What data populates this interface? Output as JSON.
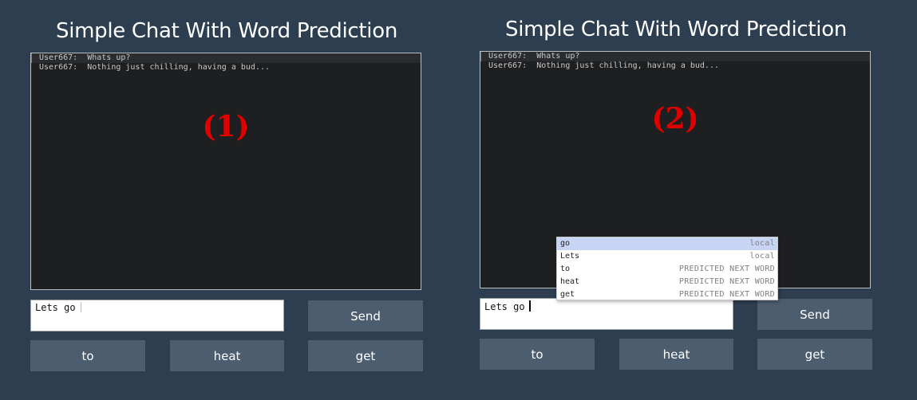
{
  "panels": [
    {
      "title": "Simple Chat With Word Prediction",
      "marker": "(1)",
      "chat": [
        {
          "user": "User667:",
          "text": "Whats up?"
        },
        {
          "user": "User667:",
          "text": "Nothing just chilling, having a bud..."
        }
      ],
      "input_value": "Lets go",
      "send_label": "Send",
      "suggestions": [
        "to",
        "heat",
        "get"
      ]
    },
    {
      "title": "Simple Chat With Word Prediction",
      "marker": "(2)",
      "chat": [
        {
          "user": "User667:",
          "text": "Whats up?"
        },
        {
          "user": "User667:",
          "text": "Nothing just chilling, having a bud..."
        }
      ],
      "input_value": "Lets go",
      "send_label": "Send",
      "suggestions": [
        "to",
        "heat",
        "get"
      ],
      "autocomplete": [
        {
          "word": "go",
          "meta": "local",
          "selected": true
        },
        {
          "word": "Lets",
          "meta": "local",
          "selected": false
        },
        {
          "word": "to",
          "meta": "PREDICTED NEXT WORD",
          "selected": false
        },
        {
          "word": "heat",
          "meta": "PREDICTED NEXT WORD",
          "selected": false
        },
        {
          "word": "get",
          "meta": "PREDICTED NEXT WORD",
          "selected": false
        }
      ]
    }
  ]
}
